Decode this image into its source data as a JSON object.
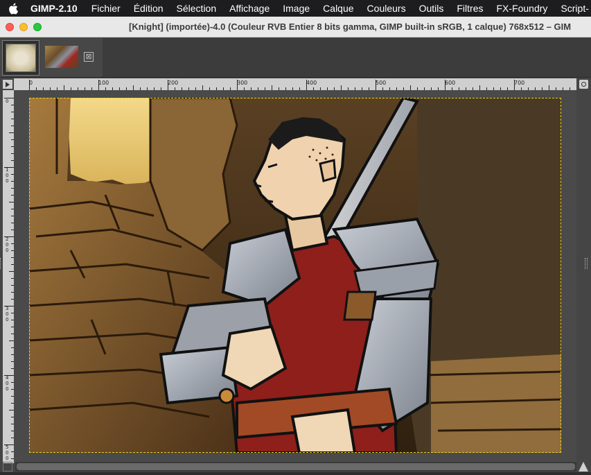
{
  "menubar": {
    "apple_icon": "apple-icon",
    "app_name": "GIMP-2.10",
    "items": [
      "Fichier",
      "Édition",
      "Sélection",
      "Affichage",
      "Image",
      "Calque",
      "Couleurs",
      "Outils",
      "Filtres",
      "FX-Foundry",
      "Script-"
    ]
  },
  "window": {
    "title": "[Knight] (importée)-4.0 (Couleur RVB Entier 8 bits gamma, GIMP built-in sRGB, 1 calque) 768x512 – GIM"
  },
  "tabs": {
    "close_symbol": "⊠",
    "items": [
      {
        "name": "image-tab-1"
      },
      {
        "name": "image-tab-knight"
      }
    ]
  },
  "ruler_h": {
    "labels": [
      "0",
      "100",
      "200",
      "300",
      "400",
      "500",
      "600",
      "700"
    ]
  },
  "ruler_v": {
    "labels": [
      "0",
      "100",
      "200",
      "300",
      "400",
      "500"
    ]
  },
  "colors": {
    "menubar": "#1d1d1f",
    "canvas": "#4a4a4a",
    "layer_border": "#e8d020",
    "ruler": "#cfcfcf"
  }
}
